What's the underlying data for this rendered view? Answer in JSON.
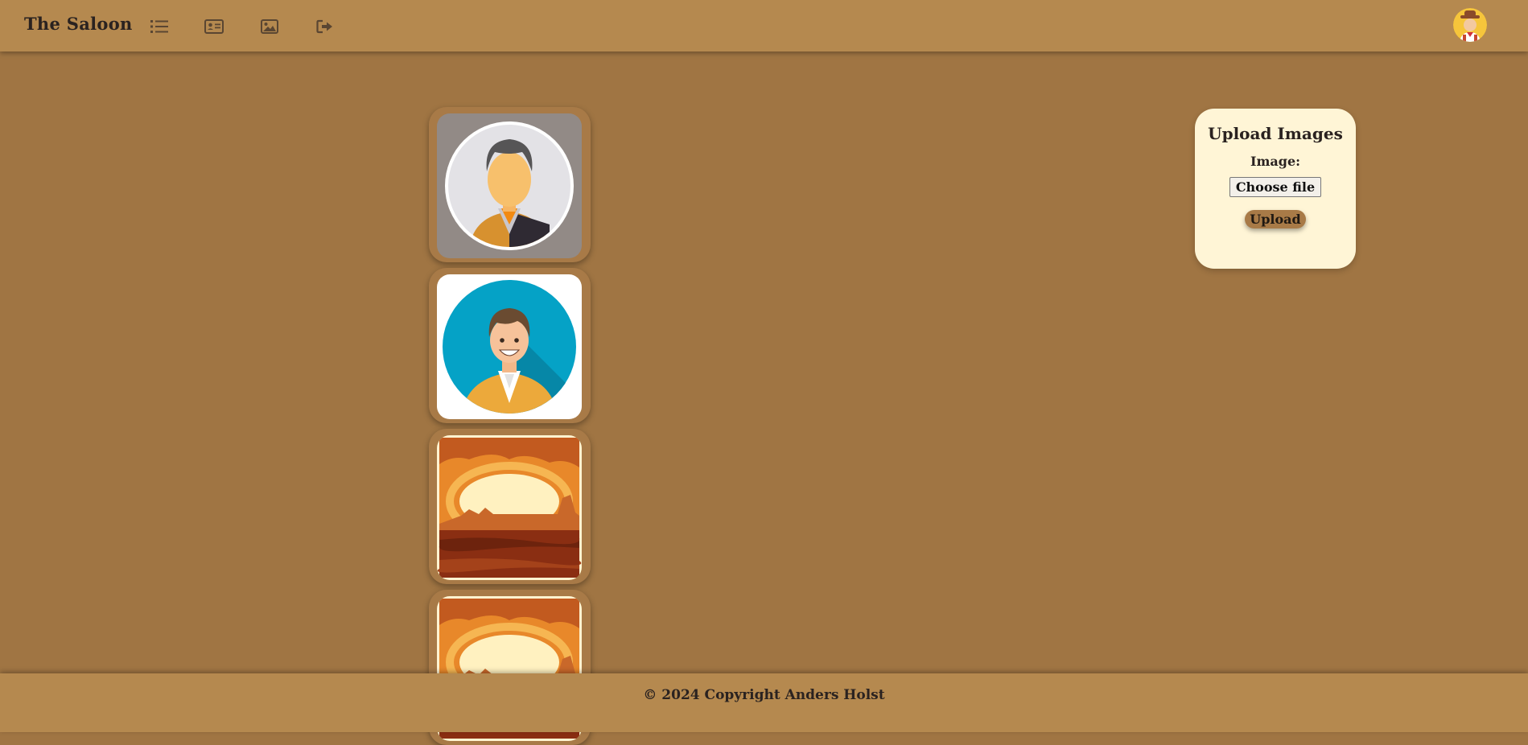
{
  "navbar": {
    "brand": "The Saloon",
    "icons": [
      "list-icon",
      "id-card-icon",
      "image-icon",
      "logout-icon"
    ],
    "avatar": "cowboy-avatar"
  },
  "gallery": {
    "images": [
      {
        "name": "man-avatar-grey"
      },
      {
        "name": "man-avatar-blue"
      },
      {
        "name": "desert-sunset"
      },
      {
        "name": "desert-sunset"
      }
    ]
  },
  "upload": {
    "title": "Upload Images",
    "image_label": "Image:",
    "file_button": "Choose file",
    "upload_button": "Upload"
  },
  "footer": {
    "text": "© 2024 Copyright Anders Holst"
  },
  "colors": {
    "background": "#a07543",
    "navbar": "#b5894f",
    "card": "#a87a47",
    "upload_card": "#fff5d6"
  }
}
